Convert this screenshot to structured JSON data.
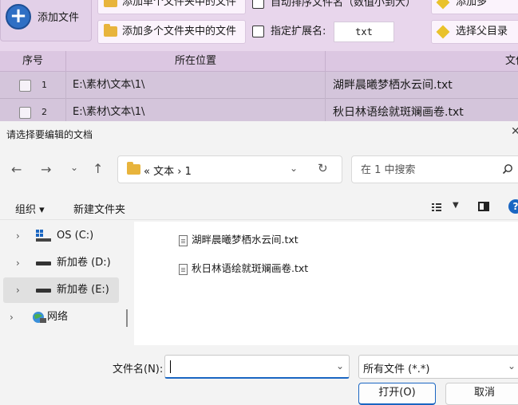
{
  "toolbar": {
    "add_file": "添加文件",
    "add_single_folder": "添加单个文件夹中的文件",
    "add_multi_folder": "添加多个文件夹中的文件",
    "auto_sort": "自动排序文件名（数值小到大）",
    "ext_label": "指定扩展名:",
    "ext_value": "txt",
    "add_more": "添加多",
    "select_parent": "选择父目录"
  },
  "table": {
    "headers": [
      "序号",
      "所在位置",
      "文件"
    ],
    "rows": [
      {
        "index": "1",
        "location": "E:\\素材\\文本\\1\\",
        "filename": "湖畔晨曦梦栖水云间.txt"
      },
      {
        "index": "2",
        "location": "E:\\素材\\文本\\1\\",
        "filename": "秋日林语绘就斑斓画卷.txt"
      }
    ]
  },
  "dialog": {
    "title": "请选择要编辑的文档",
    "close": "✕",
    "address": {
      "parts": [
        "«",
        "文本",
        "›",
        "1"
      ]
    },
    "search_placeholder": "在 1 中搜索",
    "commands": {
      "organize": "组织 ▾",
      "new_folder": "新建文件夹"
    },
    "nav": [
      {
        "label": "OS (C:)",
        "icon": "windows-drive-icon"
      },
      {
        "label": "新加卷 (D:)",
        "icon": "drive-icon"
      },
      {
        "label": "新加卷 (E:)",
        "icon": "drive-icon",
        "selected": true
      },
      {
        "label": "网络",
        "icon": "network-icon"
      }
    ],
    "files": [
      {
        "name": "湖畔晨曦梦栖水云间.txt"
      },
      {
        "name": "秋日林语绘就斑斓画卷.txt"
      }
    ],
    "filename_label": "文件名(N):",
    "filename_value": "",
    "filetype": "所有文件 (*.*)",
    "open_button": "打开(O)",
    "cancel_button": "取消"
  },
  "colors": {
    "accent": "#1a66c2",
    "toolbar_bg": "#e8d6ec",
    "row_bg": "#d4c5db"
  }
}
